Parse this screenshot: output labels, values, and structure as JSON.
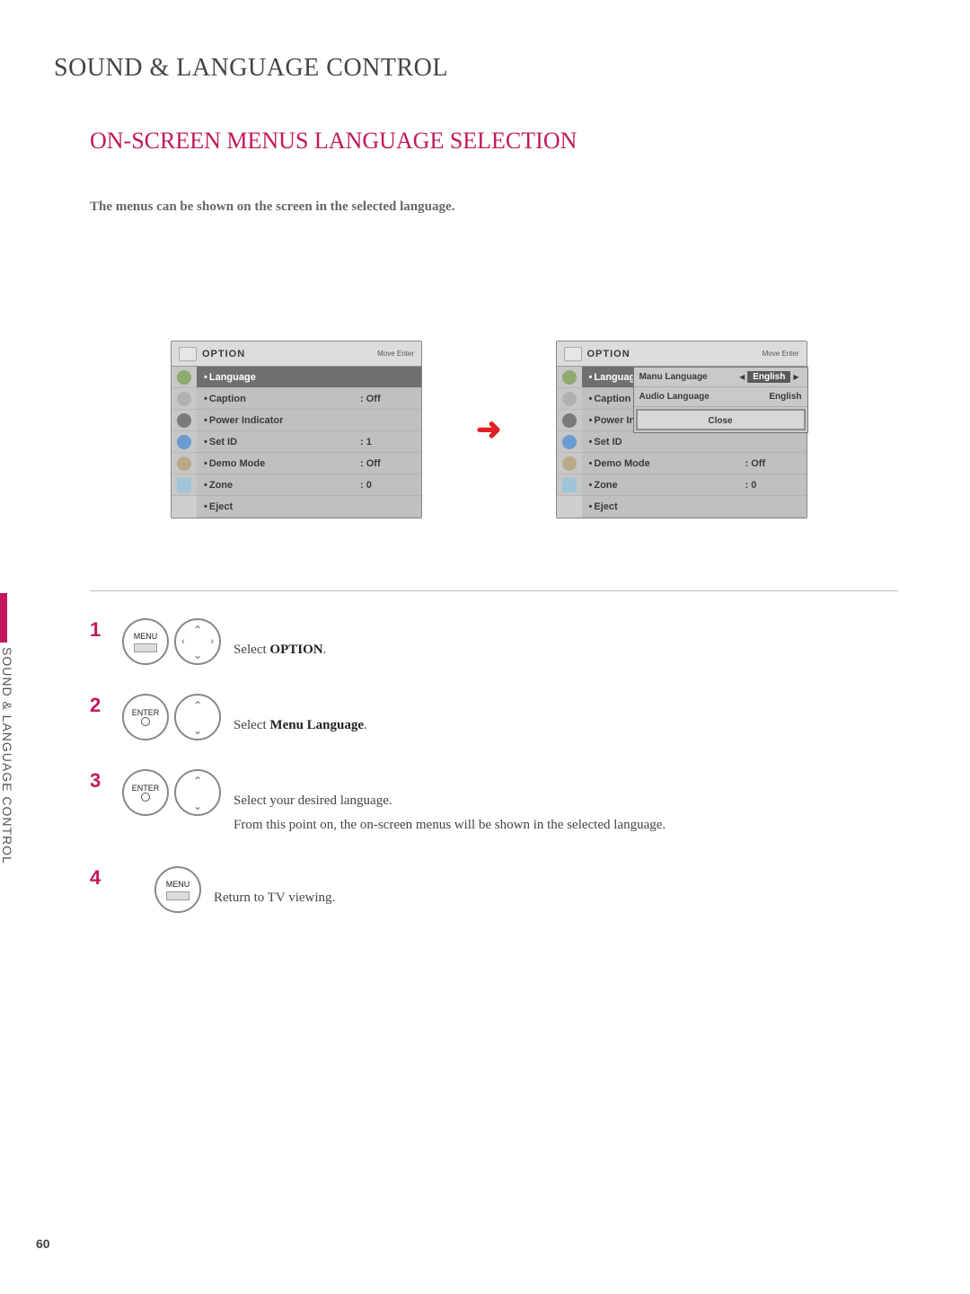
{
  "page": {
    "title": "SOUND & LANGUAGE CONTROL",
    "subtitle": "ON-SCREEN MENUS LANGUAGE SELECTION",
    "intro": "The menus can be shown on the screen in the selected language.",
    "sidetab": "SOUND & LANGUAGE CONTROL",
    "number": "60"
  },
  "osd": {
    "header_title": "OPTION",
    "header_nav": "Move    Enter",
    "items": [
      {
        "label": "Language",
        "value": ""
      },
      {
        "label": "Caption",
        "value": ": Off"
      },
      {
        "label": "Power Indicator",
        "value": ""
      },
      {
        "label": "Set ID",
        "value": ": 1"
      },
      {
        "label": "Demo Mode",
        "value": ": Off"
      },
      {
        "label": "Zone",
        "value": ": 0"
      },
      {
        "label": "Eject",
        "value": ""
      }
    ],
    "items2": [
      {
        "label": "Language",
        "value": ""
      },
      {
        "label": "Caption",
        "value": ""
      },
      {
        "label": "Power Indica",
        "value": ""
      },
      {
        "label": "Set ID",
        "value": ""
      },
      {
        "label": "Demo Mode",
        "value": ": Off"
      },
      {
        "label": "Zone",
        "value": ": 0"
      },
      {
        "label": "Eject",
        "value": ""
      }
    ],
    "popup": {
      "r1_label": "Manu Language",
      "r1_value": "English",
      "r2_label": "Audio Language",
      "r2_value": "English",
      "close": "Close"
    },
    "icon_colors": [
      "#8eaa6e",
      "#b0b0b0",
      "#7a7a7a",
      "#6b9bd1",
      "#b9a988",
      "#9ec5d8"
    ]
  },
  "steps": {
    "s1": {
      "n": "1",
      "btn": "MENU",
      "text_a": "Select ",
      "text_b": "OPTION",
      "text_c": "."
    },
    "s2": {
      "n": "2",
      "btn": "ENTER",
      "text_a": "Select ",
      "text_b": "Menu Language",
      "text_c": "."
    },
    "s3": {
      "n": "3",
      "btn": "ENTER",
      "text_a": "Select your desired language.",
      "text_b": "From this point on, the on-screen menus will be shown in the selected language."
    },
    "s4": {
      "n": "4",
      "btn": "MENU",
      "text": "Return to TV viewing."
    }
  }
}
